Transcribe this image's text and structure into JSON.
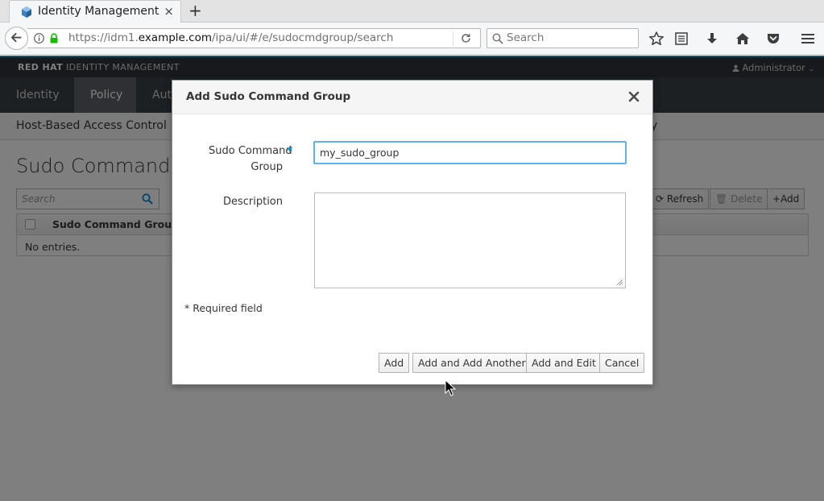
{
  "browser": {
    "tab_title": "Identity Management",
    "tab_close": "×",
    "new_tab": "+",
    "url_prefix": "https://idm1.",
    "url_domain": "example.com",
    "url_path": "/ipa/ui/#/e/sudocmdgroup/search",
    "search_placeholder": "Search"
  },
  "app": {
    "brand_bold": "RED HAT",
    "brand_rest": " IDENTITY MANAGEMENT",
    "user_menu": "Administrator",
    "nav": [
      {
        "label": "Identity"
      },
      {
        "label": "Policy"
      },
      {
        "label": "Aut"
      }
    ],
    "subnav": [
      {
        "label": "Host-Based Access Control"
      },
      {
        "label": "y"
      }
    ],
    "page_title": "Sudo Command G",
    "list_search_placeholder": "Search",
    "toolbar": {
      "refresh": "Refresh",
      "delete": "Delete",
      "add": "Add"
    },
    "table": {
      "columns": [
        "Sudo Command Group"
      ],
      "empty_text": "No entries."
    }
  },
  "modal": {
    "title": "Add Sudo Command Group",
    "fields": {
      "group_label_line1": "Sudo Command",
      "group_label_line2": "Group",
      "required_star": "*",
      "group_value": "my_sudo_group",
      "description_label": "Description",
      "description_value": ""
    },
    "required_note": "* Required field",
    "buttons": {
      "add": "Add",
      "add_another": "Add and Add Another",
      "add_edit": "Add and Edit",
      "cancel": "Cancel"
    }
  },
  "colors": {
    "accent": "#0088ce",
    "brandbar": "#2f3338",
    "nav": "#3b4046",
    "nav_active": "#5e6167",
    "focus": "#66afe9"
  }
}
